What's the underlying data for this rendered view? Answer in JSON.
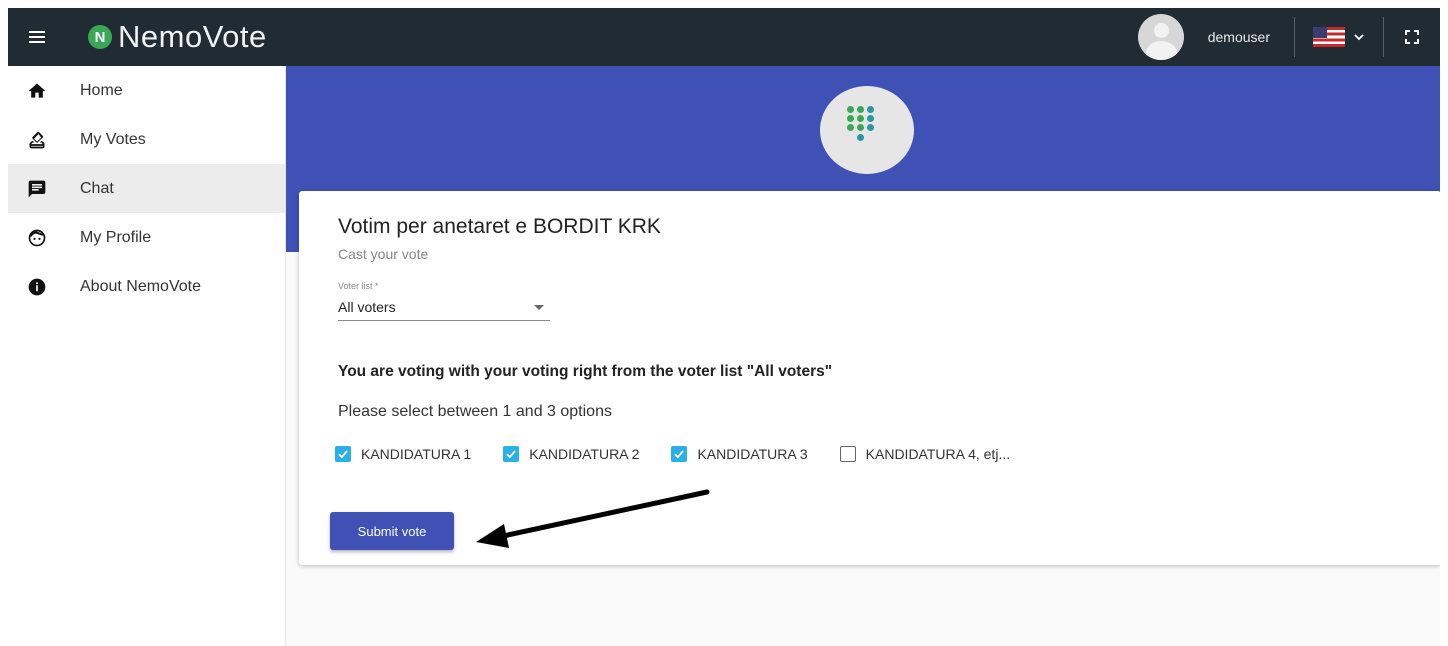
{
  "header": {
    "logo_letter": "N",
    "app_name": "NemoVote",
    "username": "demouser",
    "language_flag": "us-flag",
    "icons": [
      "menu-icon",
      "user-avatar",
      "us-flag-icon",
      "chevron-down-icon",
      "fullscreen-icon"
    ]
  },
  "sidebar": {
    "items": [
      {
        "label": "Home",
        "icon": "home-icon"
      },
      {
        "label": "My Votes",
        "icon": "ballot-icon"
      },
      {
        "label": "Chat",
        "icon": "chat-icon",
        "active": true
      },
      {
        "label": "My Profile",
        "icon": "face-icon"
      },
      {
        "label": "About NemoVote",
        "icon": "info-icon"
      }
    ]
  },
  "vote": {
    "title": "Votim per anetaret e BORDIT KRK",
    "subtitle": "Cast your vote",
    "voter_list_label": "Voter list *",
    "voter_list_value": "All voters",
    "notice": "You are voting with your voting right from the voter list \"All voters\"",
    "instruction": "Please select between 1 and 3 options",
    "options": [
      {
        "label": "KANDIDATURA 1",
        "checked": true
      },
      {
        "label": "KANDIDATURA 2",
        "checked": true
      },
      {
        "label": "KANDIDATURA 3",
        "checked": true
      },
      {
        "label": "KANDIDATURA 4, etj...",
        "checked": false
      }
    ],
    "submit_label": "Submit vote"
  },
  "colors": {
    "topbar": "#212b33",
    "primary": "#3f51b5",
    "checkbox": "#2ab0e8",
    "logo_green": "#3aa757"
  }
}
